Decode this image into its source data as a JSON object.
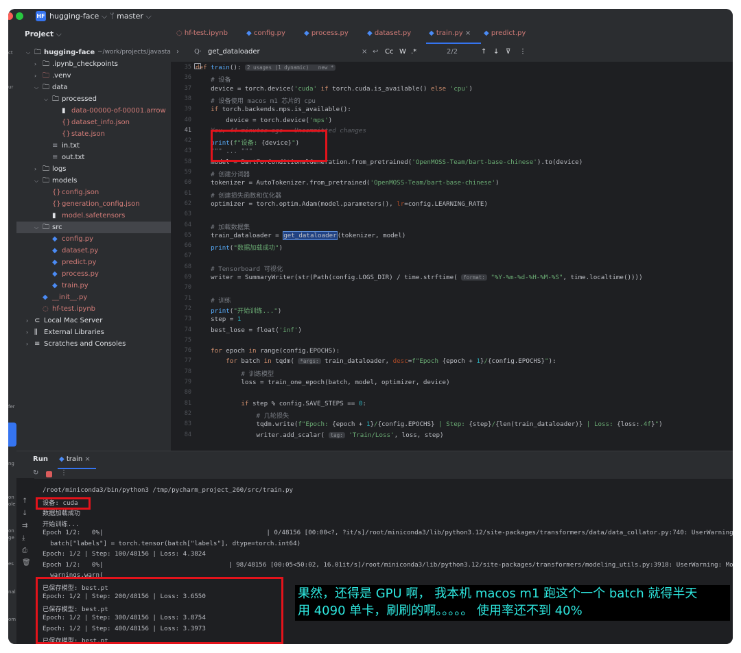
{
  "titlebar": {
    "badge": "HF",
    "project": "hugging-face",
    "branch": "master"
  },
  "strip_labels": [
    "ct",
    "ur",
    "fer",
    "ng",
    "on",
    "ole",
    "on",
    "ge",
    "es",
    "nal",
    "om"
  ],
  "project_panel": {
    "title": "Project",
    "root": "hugging-face",
    "root_path": "~/work/projects/javastarb",
    "items": [
      {
        "label": ".ipynb_checkpoints"
      },
      {
        "label": ".venv"
      },
      {
        "label": "data"
      },
      {
        "label": "processed"
      },
      {
        "label": "data-00000-of-00001.arrow"
      },
      {
        "label": "dataset_info.json"
      },
      {
        "label": "state.json"
      },
      {
        "label": "in.txt"
      },
      {
        "label": "out.txt"
      },
      {
        "label": "logs"
      },
      {
        "label": "models"
      },
      {
        "label": "config.json"
      },
      {
        "label": "generation_config.json"
      },
      {
        "label": "model.safetensors"
      },
      {
        "label": "src"
      },
      {
        "label": "config.py"
      },
      {
        "label": "dataset.py"
      },
      {
        "label": "predict.py"
      },
      {
        "label": "process.py"
      },
      {
        "label": "train.py"
      },
      {
        "label": "__init__.py"
      },
      {
        "label": "hf-test.ipynb"
      },
      {
        "label": "Local Mac Server"
      },
      {
        "label": "External Libraries"
      },
      {
        "label": "Scratches and Consoles"
      }
    ]
  },
  "tabs": [
    "hf-test.ipynb",
    "config.py",
    "process.py",
    "dataset.py",
    "train.py",
    "predict.py"
  ],
  "search": {
    "query": "get_dataloader",
    "count": "2/2",
    "cc": "Cc",
    "w": "W",
    "regex": ".*"
  },
  "code_lines": [
    {
      "n": "35",
      "parts": [
        [
          "kw",
          "def "
        ],
        [
          "fn",
          "train"
        ],
        [
          "",
          "(): "
        ],
        [
          "hint",
          "2 usages (1 dynamic)   new *"
        ]
      ]
    },
    {
      "n": "36",
      "parts": [
        [
          "cm",
          "    # 设备"
        ]
      ]
    },
    {
      "n": "37",
      "parts": [
        [
          "",
          "    device = torch.device("
        ],
        [
          "str",
          "'cuda'"
        ],
        [
          "kw",
          " if "
        ],
        [
          "",
          "torch.cuda.is_available() "
        ],
        [
          "kw",
          "else "
        ],
        [
          "str",
          "'cpu'"
        ],
        [
          "",
          ")"
        ]
      ]
    },
    {
      "n": "38",
      "parts": [
        [
          "cm",
          "    # 设备使用 macos m1 芯片的 cpu"
        ]
      ]
    },
    {
      "n": "39",
      "parts": [
        [
          "kw",
          "    if "
        ],
        [
          "",
          "torch.backends.mps.is_available():"
        ]
      ]
    },
    {
      "n": "40",
      "parts": [
        [
          "",
          "        device = torch.device("
        ],
        [
          "str",
          "'mps'"
        ],
        [
          "",
          ")"
        ]
      ]
    },
    {
      "n": "41",
      "parts": [
        [
          "blame",
          "    You, 44 minutes ago · Uncommitted changes"
        ]
      ]
    },
    {
      "n": "42",
      "parts": [
        [
          "fn",
          "    print"
        ],
        [
          "",
          "("
        ],
        [
          "str",
          "f\"设备: "
        ],
        [
          "",
          "{device}"
        ],
        [
          "str",
          "\""
        ],
        [
          "",
          ")"
        ]
      ]
    },
    {
      "n": "43",
      "parts": [
        [
          "cm",
          "    \"\"\" ... \"\"\""
        ]
      ]
    },
    {
      "n": "58",
      "parts": [
        [
          "",
          "    model = BartForConditionalGeneration.from_pretrained("
        ],
        [
          "str",
          "'OpenMOSS-Team/bart-base-chinese'"
        ],
        [
          "",
          ").to(device)"
        ]
      ]
    },
    {
      "n": "59",
      "parts": [
        [
          "cm",
          "    # 创建分词器"
        ]
      ]
    },
    {
      "n": "60",
      "parts": [
        [
          "",
          "    tokenizer = AutoTokenizer.from_pretrained("
        ],
        [
          "str",
          "'OpenMOSS-Team/bart-base-chinese'"
        ],
        [
          "",
          ")"
        ]
      ]
    },
    {
      "n": "61",
      "parts": [
        [
          "cm",
          "    # 创建损失函数和优化器"
        ]
      ]
    },
    {
      "n": "62",
      "parts": [
        [
          "",
          "    optimizer = torch.optim.Adam(model.parameters(), "
        ],
        [
          "par",
          "lr"
        ],
        [
          "",
          "=config.LEARNING_RATE)"
        ]
      ]
    },
    {
      "n": "63",
      "parts": [
        [
          "",
          ""
        ]
      ]
    },
    {
      "n": "64",
      "parts": [
        [
          "cm",
          "    # 加载数据集"
        ]
      ]
    },
    {
      "n": "65",
      "parts": [
        [
          "",
          "    train_dataloader = "
        ],
        [
          "hl",
          "get_dataloader"
        ],
        [
          "",
          "(tokenizer, model)"
        ]
      ]
    },
    {
      "n": "66",
      "parts": [
        [
          "fn",
          "    print"
        ],
        [
          "",
          "("
        ],
        [
          "str",
          "\"数据加载成功\""
        ],
        [
          "",
          ")"
        ]
      ]
    },
    {
      "n": "67",
      "parts": [
        [
          "",
          ""
        ]
      ]
    },
    {
      "n": "68",
      "parts": [
        [
          "cm",
          "    # Tensorboard 可视化"
        ]
      ]
    },
    {
      "n": "69",
      "parts": [
        [
          "",
          "    writer = SummaryWriter(str(Path(config.LOGS_DIR) / time.strftime( "
        ],
        [
          "hint",
          "format:"
        ],
        [
          "str",
          " \"%Y-%m-%d-%H-%M-%S\""
        ],
        [
          "",
          ", time.localtime())))"
        ]
      ]
    },
    {
      "n": "70",
      "parts": [
        [
          "",
          ""
        ]
      ]
    },
    {
      "n": "71",
      "parts": [
        [
          "cm",
          "    # 训练"
        ]
      ]
    },
    {
      "n": "72",
      "parts": [
        [
          "fn",
          "    print"
        ],
        [
          "",
          "("
        ],
        [
          "str",
          "\"开始训练...\""
        ],
        [
          "",
          ")"
        ]
      ]
    },
    {
      "n": "73",
      "parts": [
        [
          "",
          "    step = "
        ],
        [
          "num",
          "1"
        ]
      ]
    },
    {
      "n": "74",
      "parts": [
        [
          "",
          "    best_lose = float("
        ],
        [
          "str",
          "'inf'"
        ],
        [
          "",
          ")"
        ]
      ]
    },
    {
      "n": "75",
      "parts": [
        [
          "",
          ""
        ]
      ]
    },
    {
      "n": "76",
      "parts": [
        [
          "kw",
          "    for "
        ],
        [
          "",
          "epoch "
        ],
        [
          "kw",
          "in "
        ],
        [
          "",
          "range(config.EPOCHS):"
        ]
      ]
    },
    {
      "n": "77",
      "parts": [
        [
          "kw",
          "        for "
        ],
        [
          "",
          "batch "
        ],
        [
          "kw",
          "in "
        ],
        [
          "",
          "tqdm( "
        ],
        [
          "hint",
          "*args:"
        ],
        [
          "",
          " train_dataloader, "
        ],
        [
          "par",
          "desc"
        ],
        [
          "",
          "="
        ],
        [
          "str",
          "f\"Epoch "
        ],
        [
          "",
          "{epoch + "
        ],
        [
          "num",
          "1"
        ],
        [
          "",
          "}"
        ],
        [
          "str",
          "/"
        ],
        [
          "",
          "{config.EPOCHS}"
        ],
        [
          "str",
          "\""
        ],
        [
          "",
          "):"
        ]
      ]
    },
    {
      "n": "78",
      "parts": [
        [
          "cm",
          "            # 训练模型"
        ]
      ]
    },
    {
      "n": "79",
      "parts": [
        [
          "",
          "            loss = train_one_epoch(batch, model, optimizer, device)"
        ]
      ]
    },
    {
      "n": "80",
      "parts": [
        [
          "",
          ""
        ]
      ]
    },
    {
      "n": "81",
      "parts": [
        [
          "kw",
          "            if "
        ],
        [
          "",
          "step % config.SAVE_STEPS == "
        ],
        [
          "num",
          "0"
        ],
        [
          "",
          ":"
        ]
      ]
    },
    {
      "n": "82",
      "parts": [
        [
          "cm",
          "                # 几轮损失"
        ]
      ]
    },
    {
      "n": "83",
      "parts": [
        [
          "",
          "                tqdm.write("
        ],
        [
          "str",
          "f\"Epoch: "
        ],
        [
          "",
          "{epoch + "
        ],
        [
          "num",
          "1"
        ],
        [
          "",
          "}"
        ],
        [
          "str",
          "/"
        ],
        [
          "",
          "{config.EPOCHS}"
        ],
        [
          "str",
          " | Step: "
        ],
        [
          "",
          "{step}"
        ],
        [
          "str",
          "/"
        ],
        [
          "",
          "{len(train_dataloader)}"
        ],
        [
          "str",
          " | Loss: "
        ],
        [
          "",
          "{loss:"
        ],
        [
          "str",
          ".4f"
        ],
        [
          "",
          "}"
        ],
        [
          "str",
          "\""
        ],
        [
          "",
          ")"
        ]
      ]
    },
    {
      "n": "84",
      "parts": [
        [
          "",
          "                writer.add_scalar( "
        ],
        [
          "hint",
          "tag:"
        ],
        [
          "str",
          " 'Train/Loss'"
        ],
        [
          "",
          ", loss, step)"
        ]
      ]
    }
  ],
  "run": {
    "label": "Run",
    "config": "train"
  },
  "console_lines": [
    "/root/miniconda3/bin/python3 /tmp/pycharm_project_260/src/train.py",
    "设备: cuda",
    "数据加载成功",
    "开始训练...",
    "Epoch 1/2:   0%|                                           | 0/48156 [00:00<?, ?it/s]/root/miniconda3/lib/python3.12/site-packages/transformers/data/data_collator.py:740: UserWarning: Cre",
    "  batch[\"labels\"] = torch.tensor(batch[\"labels\"], dtype=torch.int64)",
    "Epoch: 1/2 | Step: 100/48156 | Loss: 4.3824",
    "Epoch 1/2:   0%|                                 | 98/48156 [00:05<50:02, 16.01it/s]/root/miniconda3/lib/python3.12/site-packages/transformers/modeling_utils.py:3918: UserWarning: Moving",
    "  warnings.warn(",
    "已保存模型: best.pt",
    "Epoch: 1/2 | Step: 200/48156 | Loss: 3.6550",
    "已保存模型: best.pt",
    "Epoch: 1/2 | Step: 300/48156 | Loss: 3.8754",
    "Epoch: 1/2 | Step: 400/48156 | Loss: 3.3973",
    "已保存模型: best.pt"
  ],
  "caption": {
    "line1": "果然，还得是 GPU 啊， 我本机 macos m1 跑这个一个 batch 就得半天",
    "line2": "用 4090 单卡，刷刷的啊。。。。。 使用率还不到 40%"
  },
  "colors": {
    "accent": "#3574f0",
    "annotation_red": "#e3131b",
    "caption_text": "#2ee8e0"
  }
}
